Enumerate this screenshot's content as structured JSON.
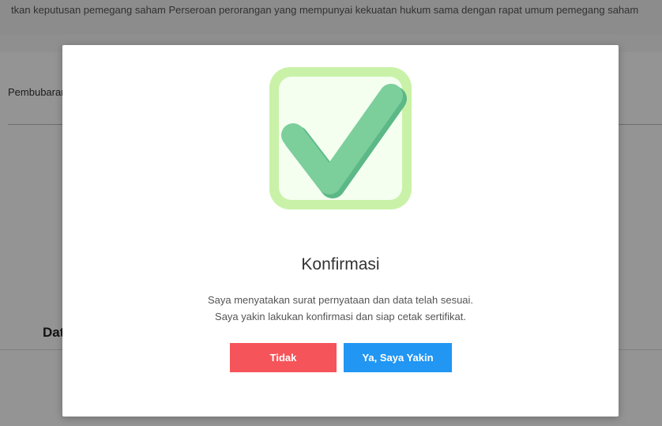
{
  "background": {
    "top_text": "tkan keputusan pemegang saham Perseroan perorangan yang mempunyai kekuatan hukum sama dengan rapat umum pemegang saham",
    "tab_label": "Pembubaran",
    "section_heading": "Data"
  },
  "modal": {
    "icon": "check-icon",
    "title": "Konfirmasi",
    "message_line1": "Saya menyatakan surat pernyataan dan data telah sesuai.",
    "message_line2": "Saya yakin lakukan konfirmasi dan siap cetak sertifikat.",
    "cancel_label": "Tidak",
    "confirm_label": "Ya, Saya Yakin"
  },
  "colors": {
    "cancel_button": "#f5545a",
    "confirm_button": "#2196f3",
    "check_green": "#7ccf9b",
    "frame_green": "#c9f2a8"
  }
}
